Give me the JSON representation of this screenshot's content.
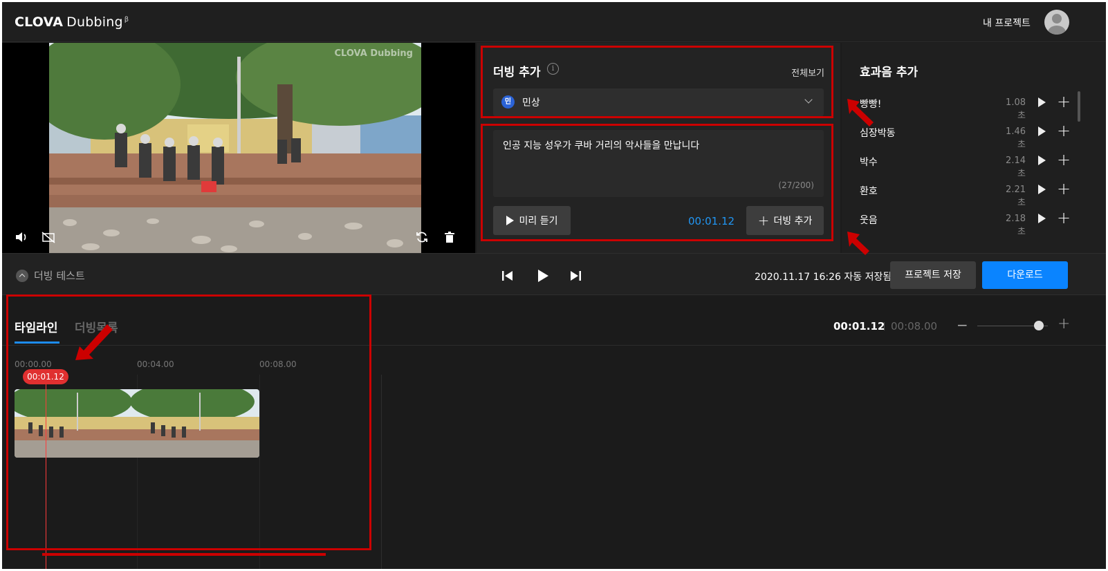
{
  "header": {
    "logo_bold": "CLOVA",
    "logo_rest": "Dubbing",
    "logo_beta": "β",
    "my_projects": "내 프로젝트"
  },
  "video": {
    "watermark": "CLOVA Dubbing"
  },
  "dubbing_panel": {
    "title": "더빙 추가",
    "info_glyph": "i",
    "view_all": "전체보기",
    "voice_badge": "민",
    "voice_name": "민상",
    "script_text": "인공 지능 성우가 쿠바 거리의 악사들을 만납니다",
    "char_count": "(27/200)",
    "preview_label": "미리 듣기",
    "time": "00:01.12",
    "add_label": "더빙 추가",
    "accent_color": "#2196f3"
  },
  "sfx_panel": {
    "title": "효과음 추가",
    "items": [
      {
        "name": "빵빵!",
        "duration": "1.08초"
      },
      {
        "name": "심장박동",
        "duration": "1.46초"
      },
      {
        "name": "박수",
        "duration": "2.14초"
      },
      {
        "name": "환호",
        "duration": "2.21초"
      },
      {
        "name": "웃음",
        "duration": "2.18초"
      }
    ]
  },
  "control_bar": {
    "dub_test": "더빙 테스트",
    "saved_status": "2020.11.17 16:26 자동 저장됨",
    "save_button": "프로젝트 저장",
    "download_button": "다운로드",
    "download_color": "#0a84ff"
  },
  "timeline": {
    "tabs": [
      "타임라인",
      "더빙목록"
    ],
    "current_time": "00:01.12",
    "total_time": "00:08.00",
    "ruler": [
      "00:00.00",
      "00:04.00",
      "00:08.00"
    ],
    "playhead_label": "00:01.12",
    "zoom_level": 0.8
  },
  "annotation_color": "#cc0000"
}
